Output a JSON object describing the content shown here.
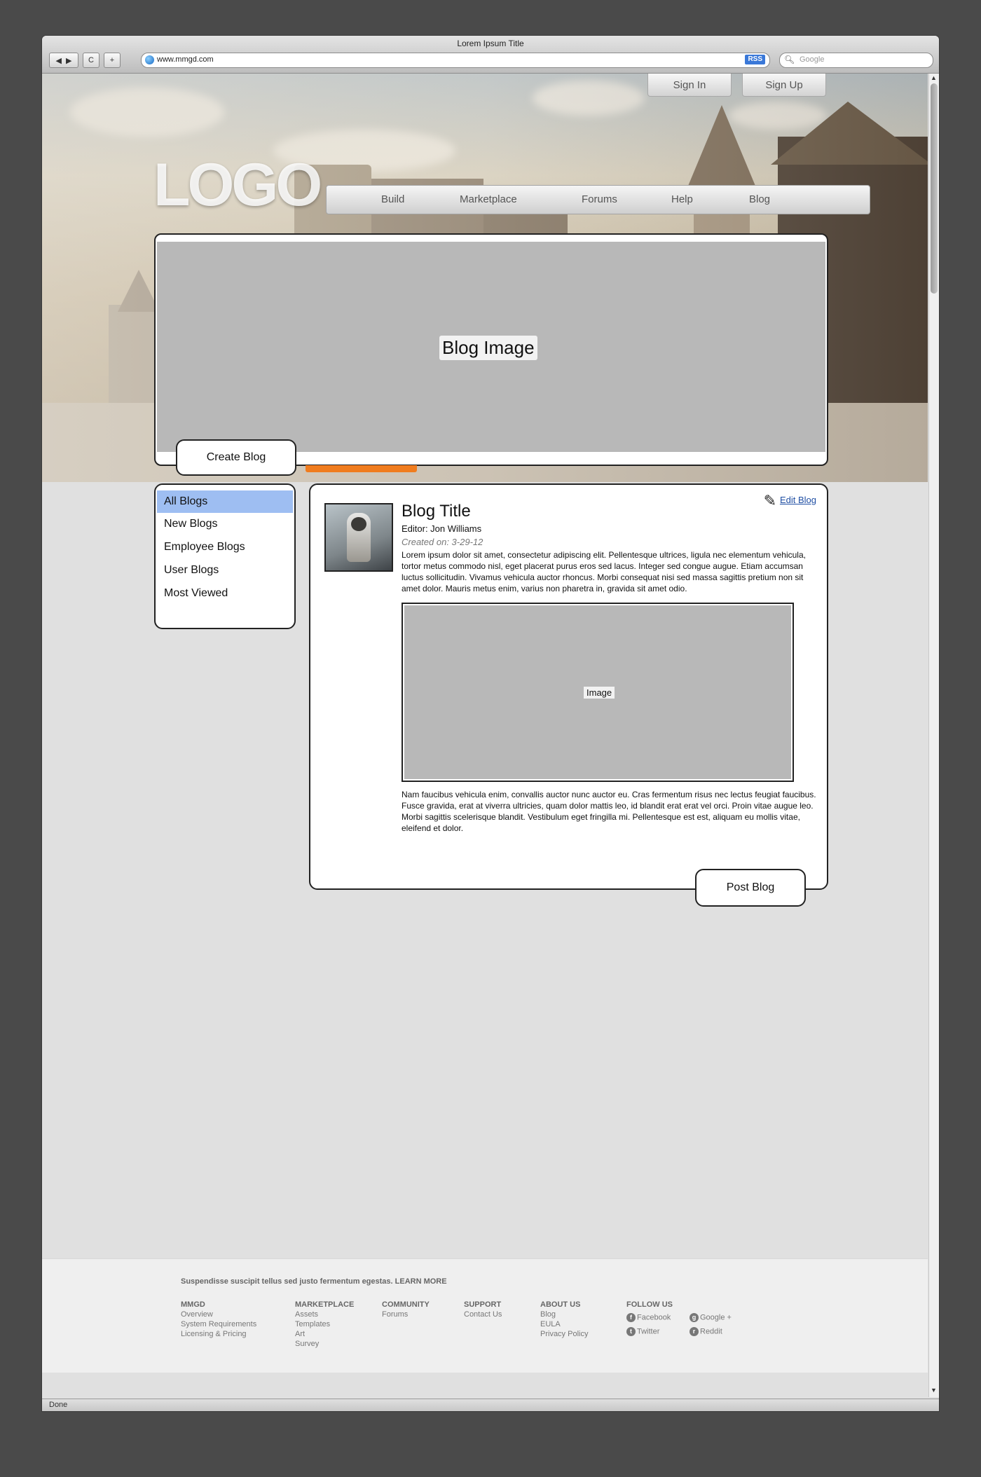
{
  "window": {
    "title": "Lorem Ipsum Title",
    "status": "Done"
  },
  "browser": {
    "url": "www.mmgd.com",
    "rss": "RSS",
    "search_placeholder": "Google",
    "back": "◀",
    "forward": "▶",
    "reload": "C",
    "new_tab": "+"
  },
  "auth": {
    "sign_in": "Sign In",
    "sign_up": "Sign Up"
  },
  "logo": "LOGO",
  "nav": [
    "Build",
    "Marketplace",
    "Forums",
    "Help",
    "Blog"
  ],
  "hero": {
    "image_label": "Blog Image",
    "create_button": "Create Blog"
  },
  "sidebar": {
    "items": [
      "All Blogs",
      "New Blogs",
      "Employee Blogs",
      "User Blogs",
      "Most Viewed"
    ],
    "selected": "All Blogs"
  },
  "post": {
    "title": "Blog Title",
    "editor": "Editor: Jon Williams",
    "created": "Created on: 3-29-12",
    "edit_label": "Edit Blog",
    "body1": "Lorem ipsum dolor sit amet, consectetur adipiscing elit. Pellentesque ultrices, ligula nec elementum vehicula, tortor metus commodo nisl, eget placerat purus eros sed lacus. Integer sed congue augue. Etiam accumsan luctus sollicitudin. Vivamus vehicula auctor rhoncus. Morbi consequat nisi sed massa sagittis pretium non sit amet dolor. Mauris metus enim, varius non pharetra in, gravida sit amet odio.",
    "image_label": "Image",
    "body2": "Nam faucibus vehicula enim, convallis auctor nunc auctor eu. Cras fermentum risus nec lectus feugiat faucibus. Fusce gravida, erat at viverra ultricies, quam dolor mattis leo, id blandit erat erat vel orci. Proin vitae augue leo. Morbi sagittis scelerisque blandit. Vestibulum eget fringilla mi. Pellentesque est est, aliquam eu mollis vitae, eleifend et dolor.",
    "post_button": "Post Blog"
  },
  "footer": {
    "tagline": "Suspendisse suscipit tellus sed justo fermentum egestas. LEARN MORE",
    "columns": [
      {
        "heading": "MMGD",
        "links": [
          "Overview",
          "System Requirements",
          "Licensing & Pricing"
        ]
      },
      {
        "heading": "MARKETPLACE",
        "links": [
          "Assets",
          "Templates",
          "Art",
          "Survey"
        ]
      },
      {
        "heading": "COMMUNITY",
        "links": [
          "Forums"
        ]
      },
      {
        "heading": "SUPPORT",
        "links": [
          "Contact Us"
        ]
      },
      {
        "heading": "ABOUT US",
        "links": [
          "Blog",
          "EULA",
          "Privacy Policy"
        ]
      }
    ],
    "follow": {
      "heading": "FOLLOW US",
      "facebook": "Facebook",
      "twitter": "Twitter",
      "google": "Google +",
      "reddit": "Reddit"
    }
  },
  "colors": {
    "selected_item": "#9ebef2",
    "accent": "#f07c1e",
    "link": "#1f4ea3"
  }
}
